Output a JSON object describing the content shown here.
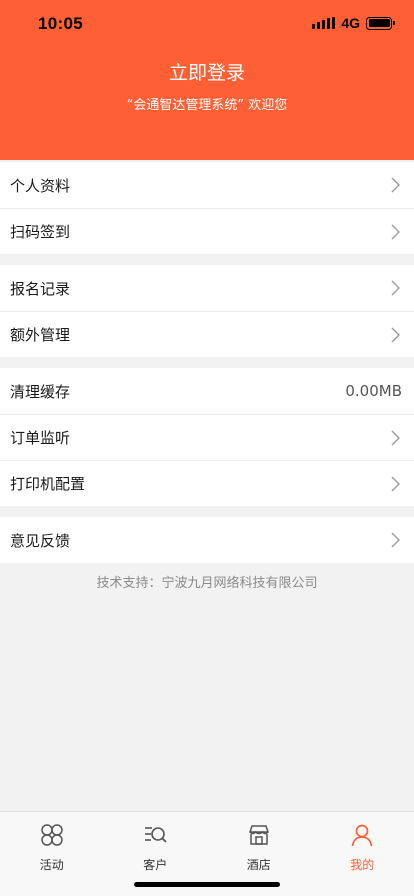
{
  "status_bar": {
    "time": "10:05",
    "network": "4G"
  },
  "header": {
    "title": "立即登录",
    "subtitle": "“会通智达管理系统” 欢迎您",
    "bg_color": "#fe5f35"
  },
  "menu_groups": [
    {
      "items": [
        {
          "label": "个人资料"
        },
        {
          "label": "扫码签到"
        }
      ]
    },
    {
      "items": [
        {
          "label": "报名记录"
        },
        {
          "label": "额外管理"
        }
      ]
    },
    {
      "items": [
        {
          "label": "清理缓存",
          "value": "0.00MB"
        },
        {
          "label": "订单监听"
        },
        {
          "label": "打印机配置"
        }
      ]
    },
    {
      "items": [
        {
          "label": "意见反馈"
        }
      ]
    }
  ],
  "footer_note": "技术支持：宁波九月网络科技有限公司",
  "tabbar": {
    "tabs": [
      {
        "label": "活动",
        "icon": "activity-icon"
      },
      {
        "label": "客户",
        "icon": "customer-icon"
      },
      {
        "label": "酒店",
        "icon": "hotel-icon"
      },
      {
        "label": "我的",
        "icon": "profile-icon",
        "active": true
      }
    ],
    "active_color": "#fe5f35"
  }
}
